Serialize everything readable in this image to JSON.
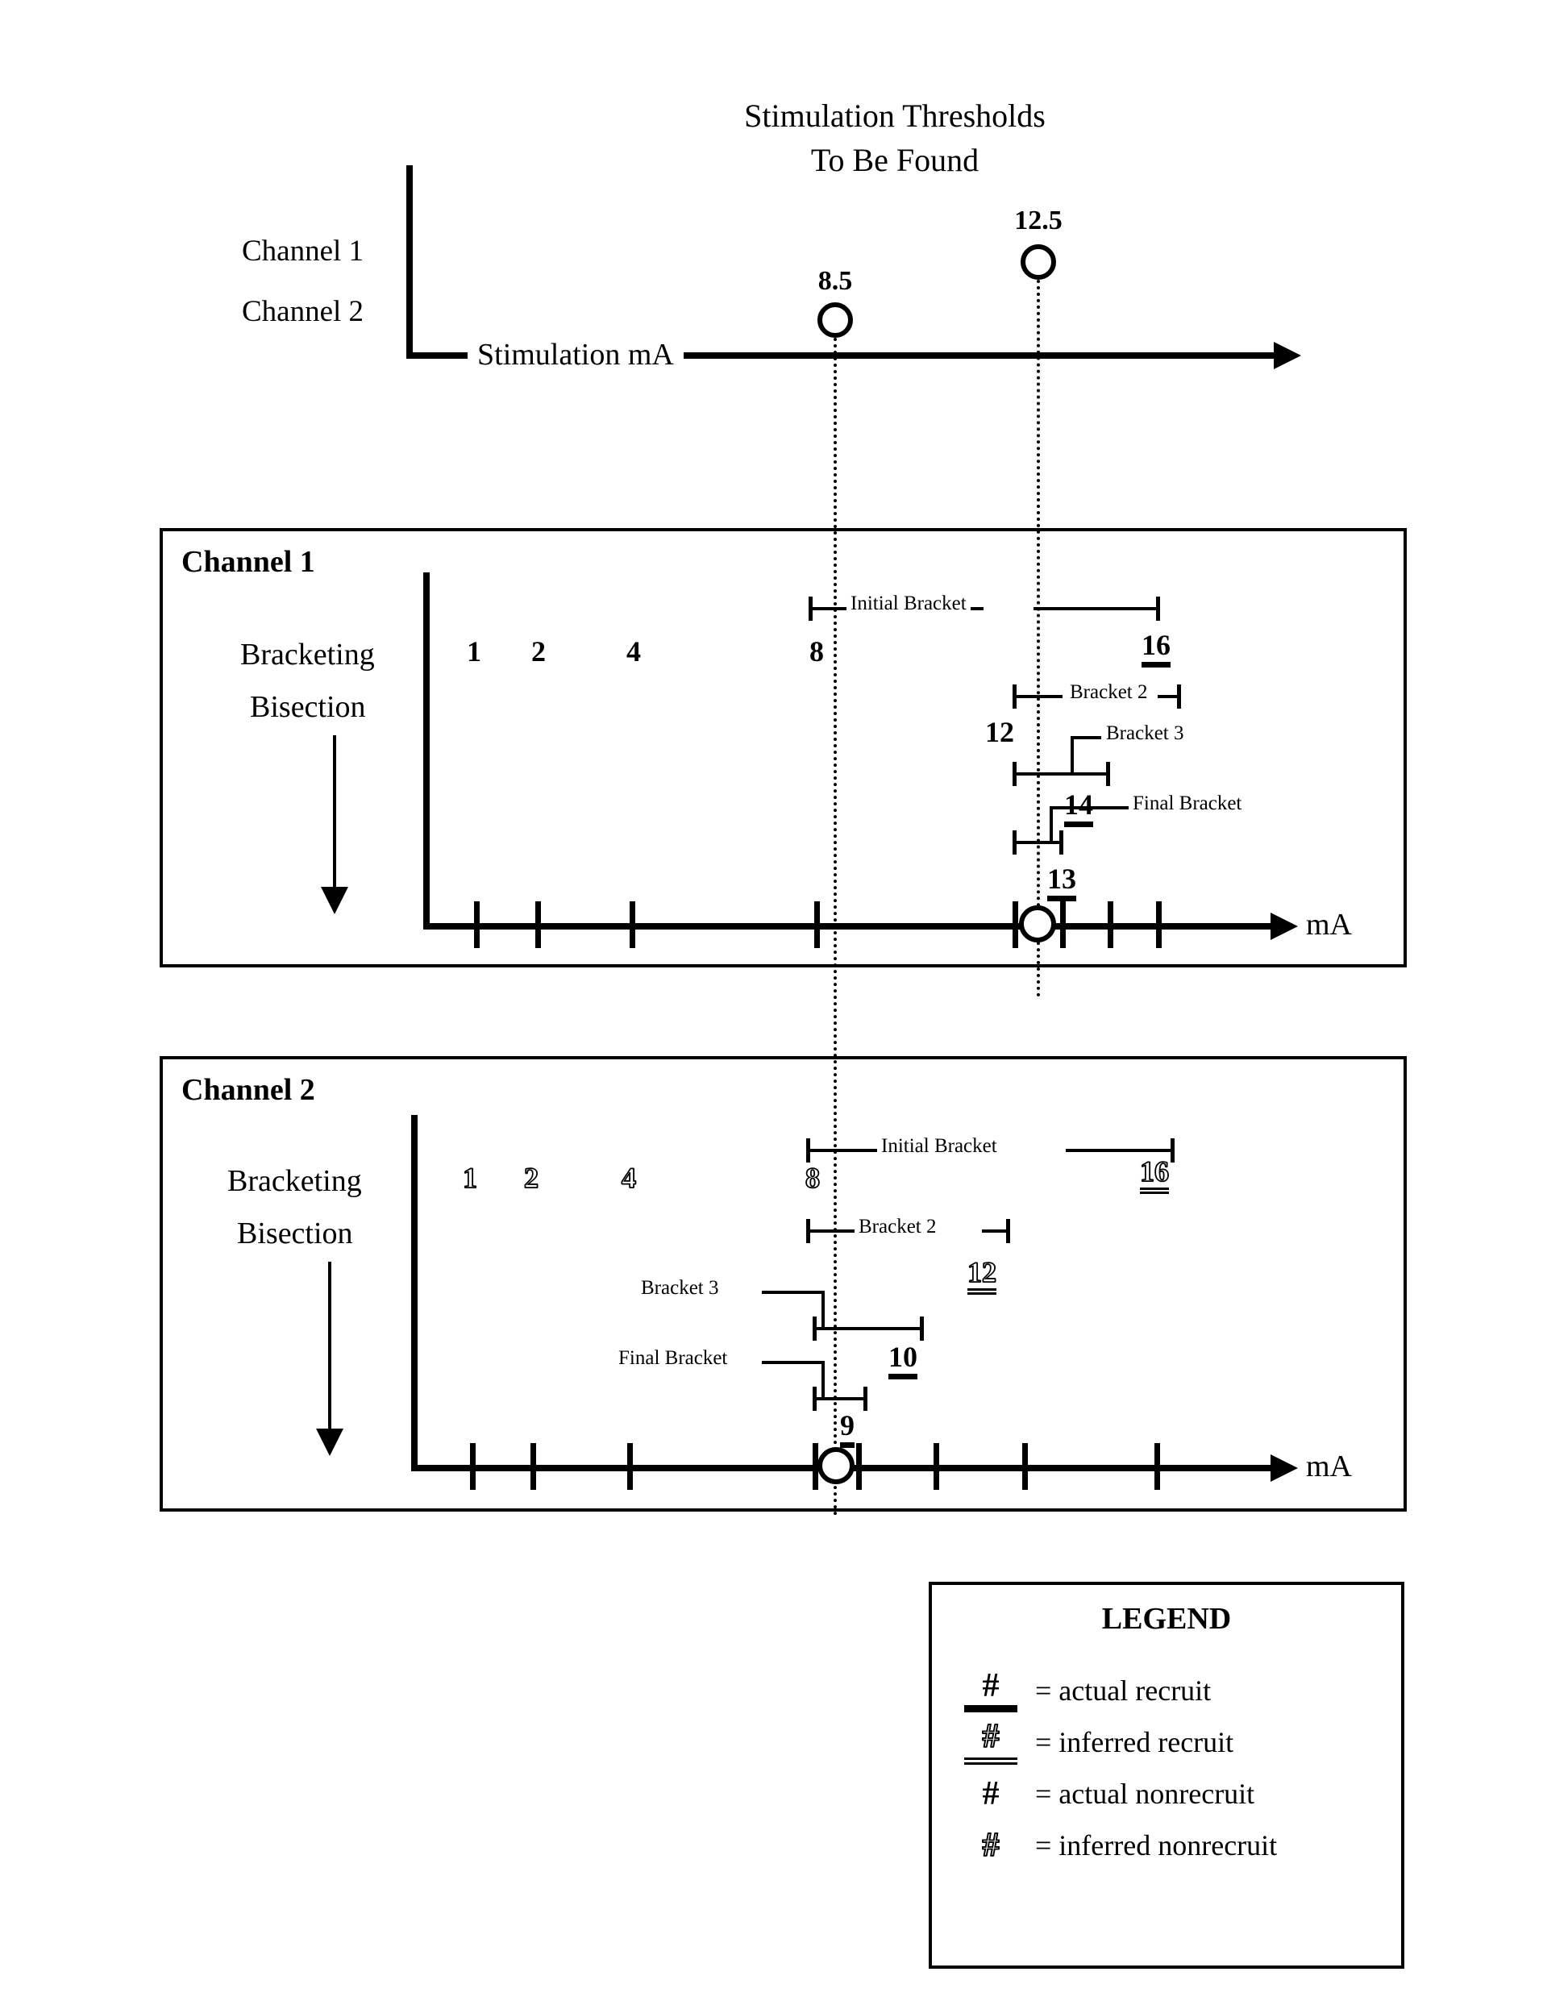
{
  "header": {
    "title_line1": "Stimulation Thresholds",
    "title_line2": "To Be Found",
    "channel1_label": "Channel 1",
    "channel2_label": "Channel 2",
    "axis_label": "Stimulation mA",
    "threshold_ch1": "12.5",
    "threshold_ch2": "8.5"
  },
  "channel1": {
    "panel_title": "Channel 1",
    "side_label_line1": "Bracketing",
    "side_label_line2": "Bisection",
    "axis_unit": "mA",
    "brackets": [
      {
        "label": "Initial Bracket"
      },
      {
        "label": "Bracket 2"
      },
      {
        "label": "Bracket 3"
      },
      {
        "label": "Final Bracket"
      }
    ],
    "values": [
      {
        "text": "1",
        "style": "actual-nonrecruit"
      },
      {
        "text": "2",
        "style": "actual-nonrecruit"
      },
      {
        "text": "4",
        "style": "actual-nonrecruit"
      },
      {
        "text": "8",
        "style": "actual-nonrecruit"
      },
      {
        "text": "16",
        "style": "actual-recruit"
      },
      {
        "text": "12",
        "style": "actual-nonrecruit"
      },
      {
        "text": "14",
        "style": "actual-recruit"
      },
      {
        "text": "13",
        "style": "actual-recruit"
      }
    ]
  },
  "channel2": {
    "panel_title": "Channel 2",
    "side_label_line1": "Bracketing",
    "side_label_line2": "Bisection",
    "axis_unit": "mA",
    "brackets": [
      {
        "label": "Initial Bracket"
      },
      {
        "label": "Bracket 2"
      },
      {
        "label": "Bracket 3"
      },
      {
        "label": "Final Bracket"
      }
    ],
    "values": [
      {
        "text": "1",
        "style": "inferred-nonrecruit"
      },
      {
        "text": "2",
        "style": "inferred-nonrecruit"
      },
      {
        "text": "4",
        "style": "inferred-nonrecruit"
      },
      {
        "text": "8",
        "style": "inferred-nonrecruit"
      },
      {
        "text": "16",
        "style": "inferred-recruit"
      },
      {
        "text": "12",
        "style": "inferred-recruit"
      },
      {
        "text": "10",
        "style": "actual-recruit"
      },
      {
        "text": "9",
        "style": "actual-recruit"
      }
    ]
  },
  "legend": {
    "title": "LEGEND",
    "rows": [
      {
        "symbol": "#",
        "equals": "= actual recruit"
      },
      {
        "symbol": "#",
        "equals": "= inferred recruit"
      },
      {
        "symbol": "#",
        "equals": "= actual nonrecruit"
      },
      {
        "symbol": "#",
        "equals": "= inferred nonrecruit"
      }
    ]
  },
  "chart_data": {
    "type": "line",
    "title": "Stimulation Thresholds To Be Found",
    "xlabel": "Stimulation mA",
    "series": [
      {
        "name": "Channel 1",
        "threshold": 12.5,
        "probes": [
          1,
          2,
          4,
          8,
          16,
          12,
          14,
          13
        ],
        "probe_results": [
          "nonrecruit",
          "nonrecruit",
          "nonrecruit",
          "nonrecruit",
          "recruit",
          "nonrecruit",
          "recruit",
          "recruit"
        ],
        "brackets": [
          [
            8,
            16
          ],
          [
            12,
            16
          ],
          [
            12,
            14
          ],
          [
            12,
            13
          ]
        ]
      },
      {
        "name": "Channel 2",
        "threshold": 8.5,
        "probes": [
          1,
          2,
          4,
          8,
          16,
          12,
          10,
          9
        ],
        "probe_results": [
          "nonrecruit",
          "nonrecruit",
          "nonrecruit",
          "nonrecruit",
          "recruit",
          "recruit",
          "recruit",
          "recruit"
        ],
        "brackets": [
          [
            8,
            16
          ],
          [
            8,
            12
          ],
          [
            8,
            10
          ],
          [
            8,
            9
          ]
        ]
      }
    ]
  }
}
